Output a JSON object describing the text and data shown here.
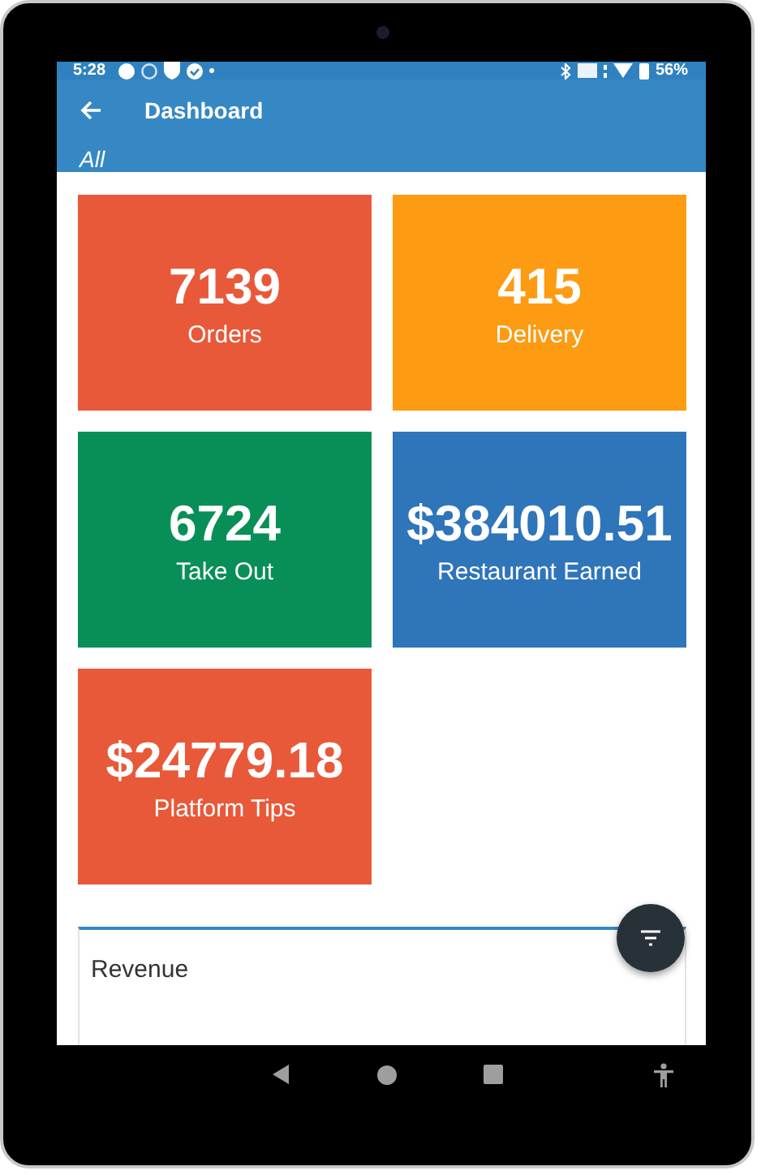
{
  "status_bar": {
    "time": "5:28",
    "battery": "56%"
  },
  "header": {
    "title": "Dashboard",
    "subtitle": "All"
  },
  "tiles": [
    {
      "value": "7139",
      "label": "Orders",
      "color": "#e8593a"
    },
    {
      "value": "415",
      "label": "Delivery",
      "color": "#fd9b12"
    },
    {
      "value": "6724",
      "label": "Take Out",
      "color": "#078f57"
    },
    {
      "value": "$384010.51",
      "label": "Restaurant Earned",
      "color": "#2e75ba"
    },
    {
      "value": "$24779.18",
      "label": "Platform Tips",
      "color": "#e8593a"
    }
  ],
  "revenue_card": {
    "title": "Revenue"
  }
}
